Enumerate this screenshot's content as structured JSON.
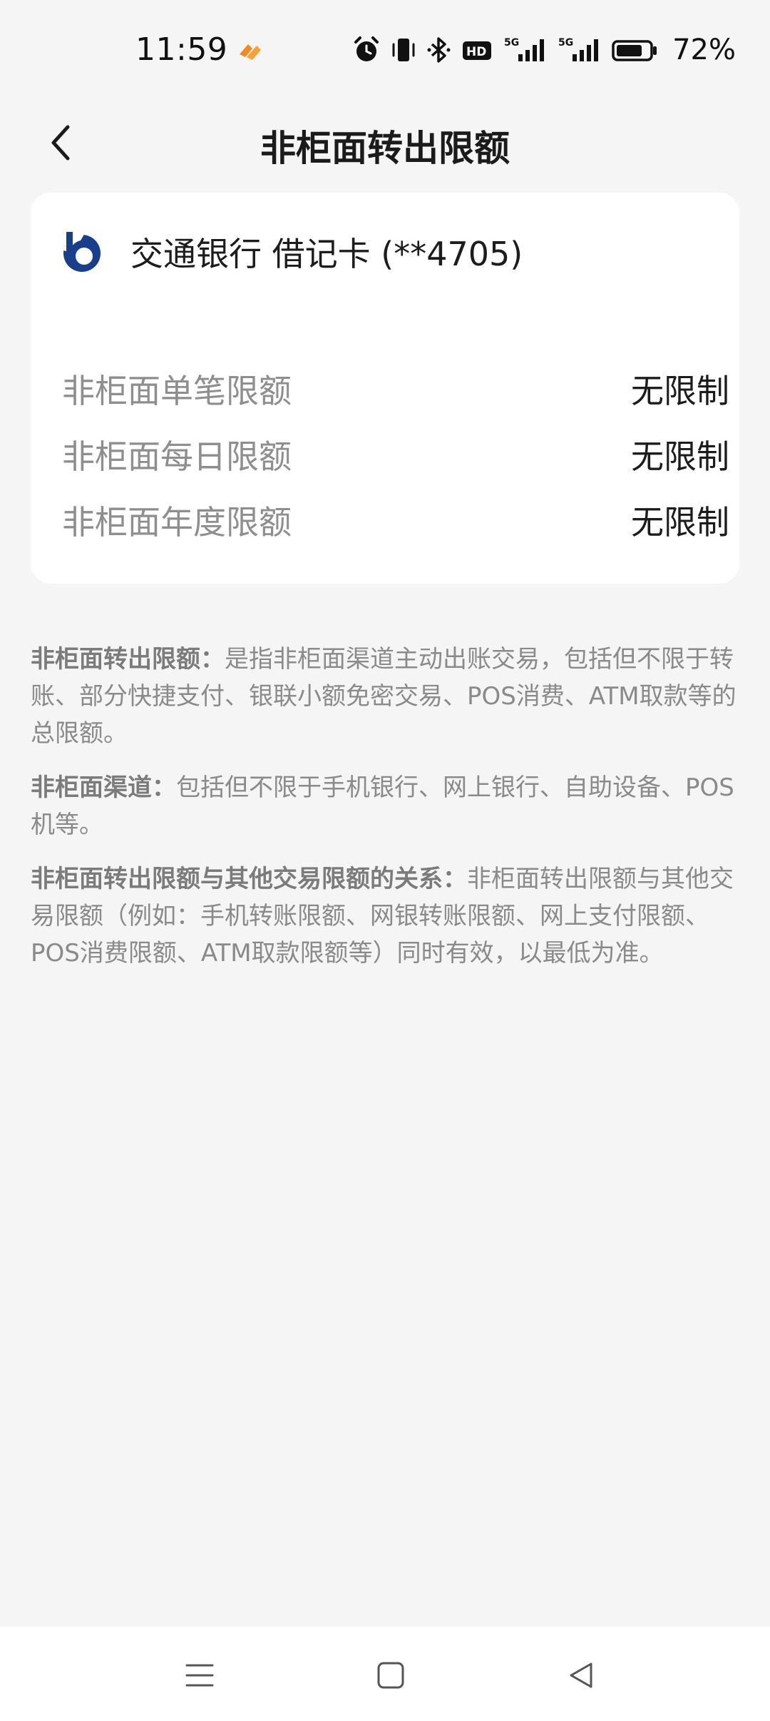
{
  "status_bar": {
    "time": "11:59",
    "battery": "72%",
    "icons": [
      "app-notification-icon",
      "alarm-icon",
      "vibrate-icon",
      "bluetooth-icon",
      "hd-icon",
      "signal-5g-icon",
      "signal-5g-icon",
      "battery-icon"
    ]
  },
  "header": {
    "title": "非柜面转出限额"
  },
  "card": {
    "bank_name": "交通银行 借记卡 (**4705)",
    "limits": [
      {
        "label": "非柜面单笔限额",
        "value": "无限制"
      },
      {
        "label": "非柜面每日限额",
        "value": "无限制"
      },
      {
        "label": "非柜面年度限额",
        "value": "无限制"
      }
    ]
  },
  "description": [
    {
      "term": "非柜面转出限额：",
      "text": "是指非柜面渠道主动出账交易，包括但不限于转账、部分快捷支付、银联小额免密交易、POS消费、ATM取款等的总限额。"
    },
    {
      "term": "非柜面渠道：",
      "text": "包括但不限于手机银行、网上银行、自助设备、POS机等。"
    },
    {
      "term": "非柜面转出限额与其他交易限额的关系：",
      "text": "非柜面转出限额与其他交易限额（例如：手机转账限额、网银转账限额、网上支付限额、POS消费限额、ATM取款限额等）同时有效，以最低为准。"
    }
  ],
  "colors": {
    "background": "#f5f5f5",
    "card": "#ffffff",
    "bank_logo": "#1a3f8a",
    "muted_text": "#8e8e8e"
  }
}
